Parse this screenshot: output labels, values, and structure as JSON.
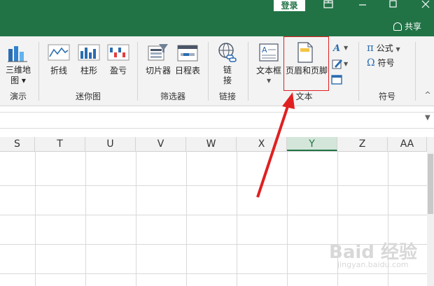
{
  "titlebar": {
    "login": "登录",
    "share": "共享"
  },
  "ribbon": {
    "tools": [
      {
        "label_line1": "三维地",
        "label_line2": "图 ▾"
      },
      {
        "label": "折线"
      },
      {
        "label": "柱形"
      },
      {
        "label": "盈亏"
      },
      {
        "label": "切片器"
      },
      {
        "label": "日程表"
      },
      {
        "label_line1": "链",
        "label_line2": "接"
      },
      {
        "label": "文本框"
      },
      {
        "label": "页眉和页脚"
      },
      {
        "label": "公式"
      },
      {
        "label": "符号"
      }
    ],
    "groups": [
      "演示",
      "迷你图",
      "筛选器",
      "链接",
      "文本",
      "符号"
    ]
  },
  "columns": [
    "S",
    "T",
    "U",
    "V",
    "W",
    "X",
    "Y",
    "Z",
    "AA"
  ],
  "selected_column": "Y",
  "watermark": {
    "main": "Baid 经验",
    "sub": "jingyan.baidu.com"
  },
  "colors": {
    "excel_green": "#217346",
    "highlight_red": "#e02020"
  }
}
